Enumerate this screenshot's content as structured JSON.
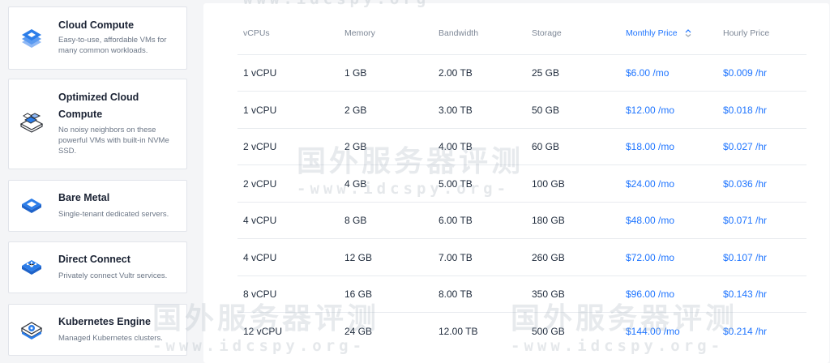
{
  "products": [
    {
      "name": "Cloud Compute",
      "desc": "Easy-to-use, affordable VMs for many common workloads.",
      "icon": "cloud-compute-icon"
    },
    {
      "name": "Optimized Cloud Compute",
      "desc": "No noisy neighbors on these powerful VMs with built-in NVMe SSD.",
      "icon": "optimized-compute-icon"
    },
    {
      "name": "Bare Metal",
      "desc": "Single-tenant dedicated servers.",
      "icon": "bare-metal-icon"
    },
    {
      "name": "Direct Connect",
      "desc": "Privately connect Vultr services.",
      "icon": "direct-connect-icon"
    },
    {
      "name": "Kubernetes Engine",
      "desc": "Managed Kubernetes clusters.",
      "icon": "kubernetes-icon"
    }
  ],
  "table": {
    "headers": [
      "vCPUs",
      "Memory",
      "Bandwidth",
      "Storage",
      "Monthly Price",
      "Hourly Price"
    ],
    "sorted_column": "Monthly Price",
    "rows": [
      [
        "1 vCPU",
        "1 GB",
        "2.00 TB",
        "25 GB",
        "$6.00 /mo",
        "$0.009 /hr"
      ],
      [
        "1 vCPU",
        "2 GB",
        "3.00 TB",
        "50 GB",
        "$12.00 /mo",
        "$0.018 /hr"
      ],
      [
        "2 vCPU",
        "2 GB",
        "4.00 TB",
        "60 GB",
        "$18.00 /mo",
        "$0.027 /hr"
      ],
      [
        "2 vCPU",
        "4 GB",
        "5.00 TB",
        "100 GB",
        "$24.00 /mo",
        "$0.036 /hr"
      ],
      [
        "4 vCPU",
        "8 GB",
        "6.00 TB",
        "180 GB",
        "$48.00 /mo",
        "$0.071 /hr"
      ],
      [
        "4 vCPU",
        "12 GB",
        "7.00 TB",
        "260 GB",
        "$72.00 /mo",
        "$0.107 /hr"
      ],
      [
        "8 vCPU",
        "16 GB",
        "8.00 TB",
        "350 GB",
        "$96.00 /mo",
        "$0.143 /hr"
      ],
      [
        "12 vCPU",
        "24 GB",
        "12.00 TB",
        "500 GB",
        "$144.00 /mo",
        "$0.214 /hr"
      ]
    ]
  },
  "watermark": {
    "title": "国外服务器评测",
    "url": "-www.idcspy.org-",
    "url_top": "www.idcspy.org"
  },
  "colors": {
    "accent": "#1f75ff",
    "icon_blue": "#2b7de9"
  }
}
